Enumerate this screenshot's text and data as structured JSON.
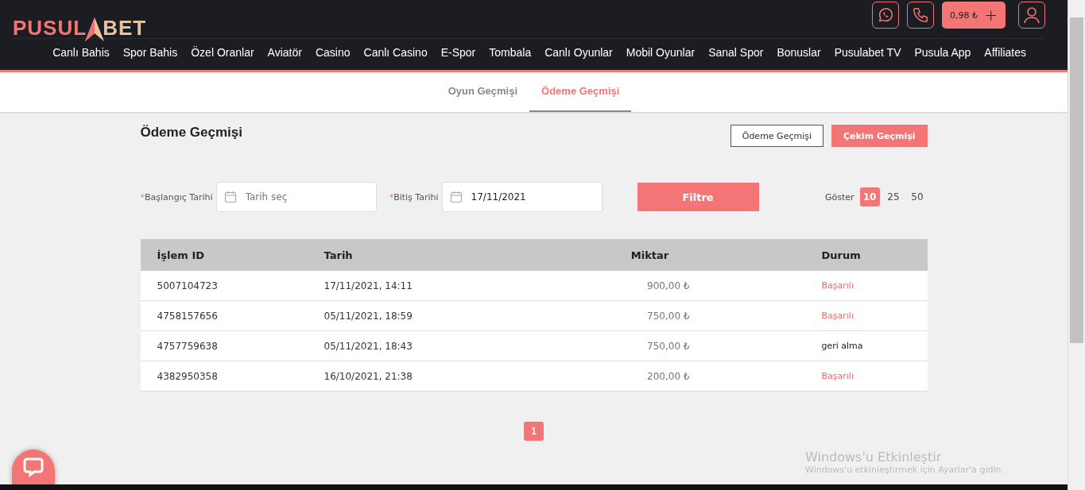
{
  "header": {
    "logo": {
      "left": "PUSUL",
      "right": "BET"
    },
    "balance": "0,98 ₺",
    "balance_add": "+",
    "nav": [
      "Canlı Bahis",
      "Spor Bahis",
      "Özel Oranlar",
      "Aviatör",
      "Casino",
      "Canlı Casino",
      "E-Spor",
      "Tombala",
      "Canlı Oyunlar",
      "Mobil Oyunlar",
      "Sanal Spor",
      "Bonuslar",
      "Pusulabet TV",
      "Pusula App",
      "Affiliates"
    ]
  },
  "tabs": [
    {
      "label": "Oyun Geçmişi",
      "selected": false
    },
    {
      "label": "Ödeme Geçmişi",
      "selected": true
    }
  ],
  "page_title": "Ödeme Geçmişi",
  "type_buttons": [
    {
      "label": "Ödeme Geçmişi",
      "selected": false
    },
    {
      "label": "Çekim Geçmişi",
      "selected": true
    }
  ],
  "filters": [
    {
      "required": "*",
      "label": "Başlangıç Tarihi",
      "placeholder": "Tarih seç"
    },
    {
      "required": "*",
      "label": "Bitiş Tarihi",
      "value": "17/11/2021"
    }
  ],
  "filter_button": "Filtre",
  "page_size": {
    "label": "Göster",
    "options": [
      {
        "label": "10",
        "selected": true
      },
      {
        "label": "25",
        "selected": false
      },
      {
        "label": "50",
        "selected": false
      }
    ]
  },
  "table": {
    "columns": [
      "İşlem ID",
      "Tarih",
      "Miktar",
      "Durum"
    ],
    "rows": [
      {
        "id": "5007104723",
        "date": "17/11/2021, 14:11",
        "amount": "900,00 ₺",
        "status": "Başarılı",
        "kind": "success"
      },
      {
        "id": "4758157656",
        "date": "05/11/2021, 18:59",
        "amount": "750,00 ₺",
        "status": "Başarılı",
        "kind": "success"
      },
      {
        "id": "4757759638",
        "date": "05/11/2021, 18:43",
        "amount": "750,00 ₺",
        "status": "geri alma",
        "kind": "other"
      },
      {
        "id": "4382950358",
        "date": "16/10/2021, 21:38",
        "amount": "200,00 ₺",
        "status": "Başarılı",
        "kind": "success"
      }
    ]
  },
  "pagination": [
    {
      "label": "1",
      "selected": true
    }
  ],
  "os_notice": {
    "title": "Windows'u Etkinleştir",
    "text": "Windows'u etkinleştirmek için Ayarlar'a gidin."
  }
}
